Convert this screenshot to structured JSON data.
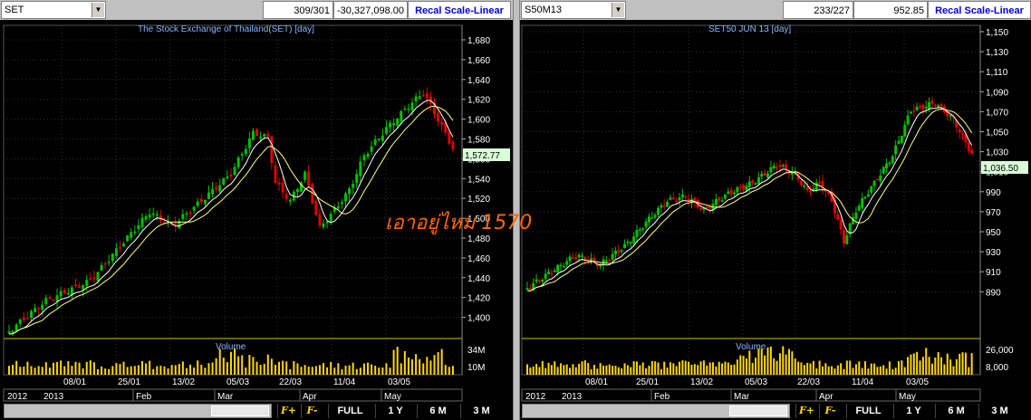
{
  "left": {
    "symbol": "SET",
    "counts": "309/301",
    "value": "-30,327,098.00",
    "recal_label": "Recal Scale-Linear",
    "chart_title": "The Stock Exchange of Thailand(SET) [day]",
    "last_price": "1,572.77",
    "volume_label": "Volume",
    "y_ticks": [
      "1,680",
      "1,660",
      "1,640",
      "1,620",
      "1,600",
      "1,580",
      "1,560",
      "1,540",
      "1,520",
      "1,500",
      "1,480",
      "1,460",
      "1,440",
      "1,420",
      "1,400"
    ],
    "vol_ticks": [
      "34M",
      "10M"
    ],
    "date_ticks": [
      "08/01",
      "25/01",
      "13/02",
      "05/03",
      "22/03",
      "11/04",
      "03/05"
    ],
    "year_labels": [
      "2012",
      "2013"
    ],
    "month_labels": [
      "Feb",
      "Mar",
      "Apr",
      "May"
    ]
  },
  "right": {
    "symbol": "S50M13",
    "counts": "233/227",
    "value": "952.85",
    "recal_label": "Recal Scale-Linear",
    "chart_title": "SET50 JUN 13   [day]",
    "last_price": "1,036.50",
    "volume_label": "Volume",
    "y_ticks": [
      "1,150",
      "1,130",
      "1,110",
      "1,090",
      "1,070",
      "1,050",
      "1,030",
      "1,010",
      "990",
      "970",
      "950",
      "930",
      "910",
      "890"
    ],
    "vol_ticks": [
      "26,000",
      "8,000"
    ],
    "date_ticks": [
      "08/01",
      "25/01",
      "13/02",
      "05/03",
      "22/03",
      "11/04",
      "03/05"
    ],
    "year_labels": [
      "2012",
      "2013"
    ],
    "month_labels": [
      "Feb",
      "Mar",
      "Apr",
      "May"
    ]
  },
  "toolbar": {
    "f_plus": "F+",
    "f_minus": "F-",
    "full": "FULL",
    "y1": "1 Y",
    "m6": "6 M",
    "m3": "3 M"
  },
  "overlay_text": "เอาอยู่ไหม 1570",
  "colors": {
    "up": "#00c000",
    "down": "#e00000",
    "ma": "#ffff80",
    "grid": "#303030",
    "axis_frame": "#c8c800"
  }
}
